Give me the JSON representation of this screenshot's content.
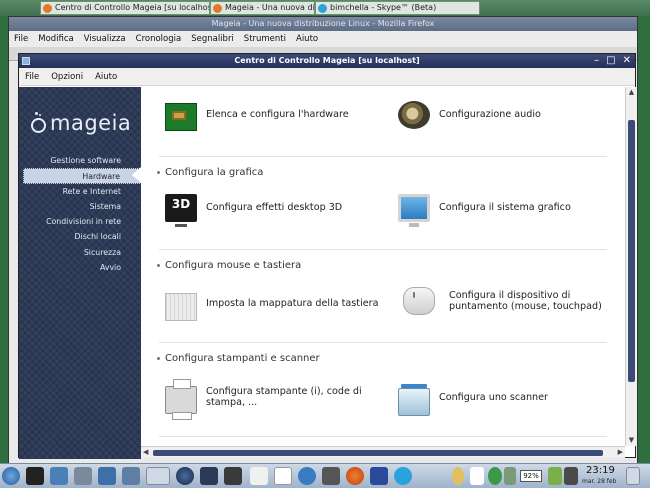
{
  "top_strip": {
    "window1_title": "Centro di Controllo Mageia  [su localhost]",
    "window2_title": "Mageia - Una nuova distribuzione Linux - Mozilla Firefox",
    "window3_title": "bimchella - Skype™ (Beta)"
  },
  "firefox": {
    "title": "Mageia - Una nuova distribuzione Linux - Mozilla Firefox",
    "menu": [
      "File",
      "Modifica",
      "Visualizza",
      "Cronologia",
      "Segnalibri",
      "Strumenti",
      "Aiuto"
    ]
  },
  "window": {
    "title": "Centro di Controllo Mageia  [su localhost]",
    "controls": [
      "–",
      "□",
      "✕"
    ],
    "menu": [
      "File",
      "Opzioni",
      "Aiuto"
    ]
  },
  "sidebar": {
    "logo_text": "mageia",
    "items": [
      {
        "label": "Gestione software",
        "active": false
      },
      {
        "label": "Hardware",
        "active": true
      },
      {
        "label": "Rete e Internet",
        "active": false
      },
      {
        "label": "Sistema",
        "active": false
      },
      {
        "label": "Condivisioni in rete",
        "active": false
      },
      {
        "label": "Dischi locali",
        "active": false
      },
      {
        "label": "Sicurezza",
        "active": false
      },
      {
        "label": "Avvio",
        "active": false
      }
    ]
  },
  "content": {
    "top_items": [
      {
        "icon": "hardware-card-icon",
        "label": "Elenca e configura l'hardware"
      },
      {
        "icon": "speaker-icon",
        "label": "Configurazione audio"
      }
    ],
    "sections": [
      {
        "title": "Configura la grafica",
        "items": [
          {
            "icon": "3d-icon",
            "label": "Configura effetti desktop 3D"
          },
          {
            "icon": "monitor-icon",
            "label": "Configura il sistema grafico"
          }
        ]
      },
      {
        "title": "Configura mouse e tastiera",
        "items": [
          {
            "icon": "keyboard-icon",
            "label": "Imposta la mappatura della tastiera"
          },
          {
            "icon": "mouse-icon",
            "label": "Configura il dispositivo di puntamento (mouse, touchpad)"
          }
        ]
      },
      {
        "title": "Configura stampanti e scanner",
        "items": [
          {
            "icon": "printer-icon",
            "label": "Configura stampante (i), code di stampa, ..."
          },
          {
            "icon": "scanner-icon",
            "label": "Configura uno scanner"
          }
        ]
      }
    ]
  },
  "taskbar": {
    "time": "23:19",
    "date": "mar. 28 feb",
    "battery": "92%"
  }
}
